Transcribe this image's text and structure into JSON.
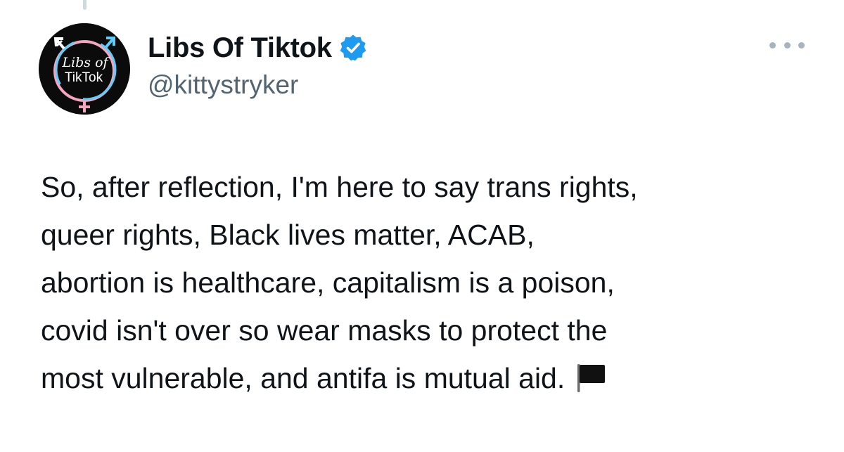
{
  "tweet": {
    "author": {
      "display_name": "Libs Of Tiktok",
      "handle": "@kittystryker",
      "verified": true,
      "avatar": {
        "text_line1": "Libs of",
        "text_line2": "TikTok"
      }
    },
    "more_button": {
      "icon": "more-horizontal-icon"
    },
    "text_lines": [
      "So, after reflection, I'm here to say trans rights,",
      "queer rights, Black lives matter, ACAB,",
      "abortion is healthcare, capitalism is a poison,",
      "covid isn't over so wear masks to protect the",
      "most vulnerable, and antifa is mutual aid."
    ],
    "trailing_emoji": "black-flag-icon"
  },
  "colors": {
    "text": "#0f1419",
    "secondary_text": "#536471",
    "verified_badge": "#1d9bf0",
    "avatar_background": "#0b0b0b",
    "avatar_pink": "#f4a6c0",
    "avatar_blue": "#5bcefa"
  }
}
